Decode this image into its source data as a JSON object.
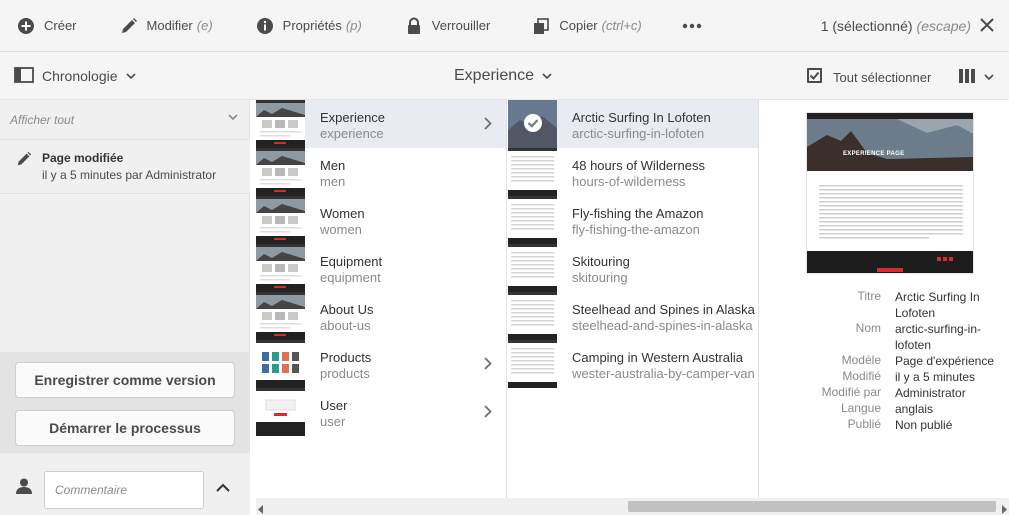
{
  "actionbar": {
    "create": {
      "label": "Créer",
      "icon": "plus-circle-icon"
    },
    "edit": {
      "label": "Modifier",
      "shortcut": "(e)",
      "icon": "pencil-icon"
    },
    "properties": {
      "label": "Propriétés",
      "shortcut": "(p)",
      "icon": "info-icon"
    },
    "lock": {
      "label": "Verrouiller",
      "icon": "lock-icon"
    },
    "copy": {
      "label": "Copier",
      "shortcut": "(ctrl+c)",
      "icon": "copy-icon"
    },
    "more_icon": "more-icon",
    "selection_count": "1 (sélectionné)",
    "selection_escape": "(escape)"
  },
  "toolbar": {
    "rail_label": "Chronologie",
    "title": "Experience",
    "select_all": "Tout sélectionner"
  },
  "rail": {
    "filter": "Afficher tout",
    "event_title": "Page modifiée",
    "event_detail": "il y a 5 minutes par Administrator",
    "save_version": "Enregistrer comme version",
    "start_workflow": "Démarrer le processus",
    "comment_placeholder": "Commentaire"
  },
  "column1": [
    {
      "title": "Experience",
      "name": "experience",
      "has_children": true,
      "active": true
    },
    {
      "title": "Men",
      "name": "men",
      "has_children": false
    },
    {
      "title": "Women",
      "name": "women",
      "has_children": false
    },
    {
      "title": "Equipment",
      "name": "equipment",
      "has_children": false
    },
    {
      "title": "About Us",
      "name": "about-us",
      "has_children": false
    },
    {
      "title": "Products",
      "name": "products",
      "has_children": true
    },
    {
      "title": "User",
      "name": "user",
      "has_children": true
    }
  ],
  "column2": [
    {
      "title": "Arctic Surfing In Lofoten",
      "name": "arctic-surfing-in-lofoten",
      "selected": true
    },
    {
      "title": "48 hours of Wilderness",
      "name": "hours-of-wilderness"
    },
    {
      "title": "Fly-fishing the Amazon",
      "name": "fly-fishing-the-amazon"
    },
    {
      "title": "Skitouring",
      "name": "skitouring"
    },
    {
      "title": "Steelhead and Spines in Alaska",
      "name": "steelhead-and-spines-in-alaska"
    },
    {
      "title": "Camping in Western Australia",
      "name": "wester-australia-by-camper-van"
    }
  ],
  "preview": {
    "image_text": "EXPERIENCE PAGE",
    "meta": [
      {
        "key": "Titre",
        "value": "Arctic Surfing In Lofoten"
      },
      {
        "key": "Nom",
        "value": "arctic-surfing-in-lofoten"
      },
      {
        "key": "Modèle",
        "value": "Page d'expérience"
      },
      {
        "key": "Modifié",
        "value": "il y a 5 minutes"
      },
      {
        "key": "Modifié par",
        "value": "Administrator"
      },
      {
        "key": "Langue",
        "value": "anglais"
      },
      {
        "key": "Publié",
        "value": "Non publié"
      }
    ]
  },
  "colors": {
    "active_row": "#e8ecf1",
    "text": "#4b4b4b",
    "muted": "#8a8a8a"
  }
}
